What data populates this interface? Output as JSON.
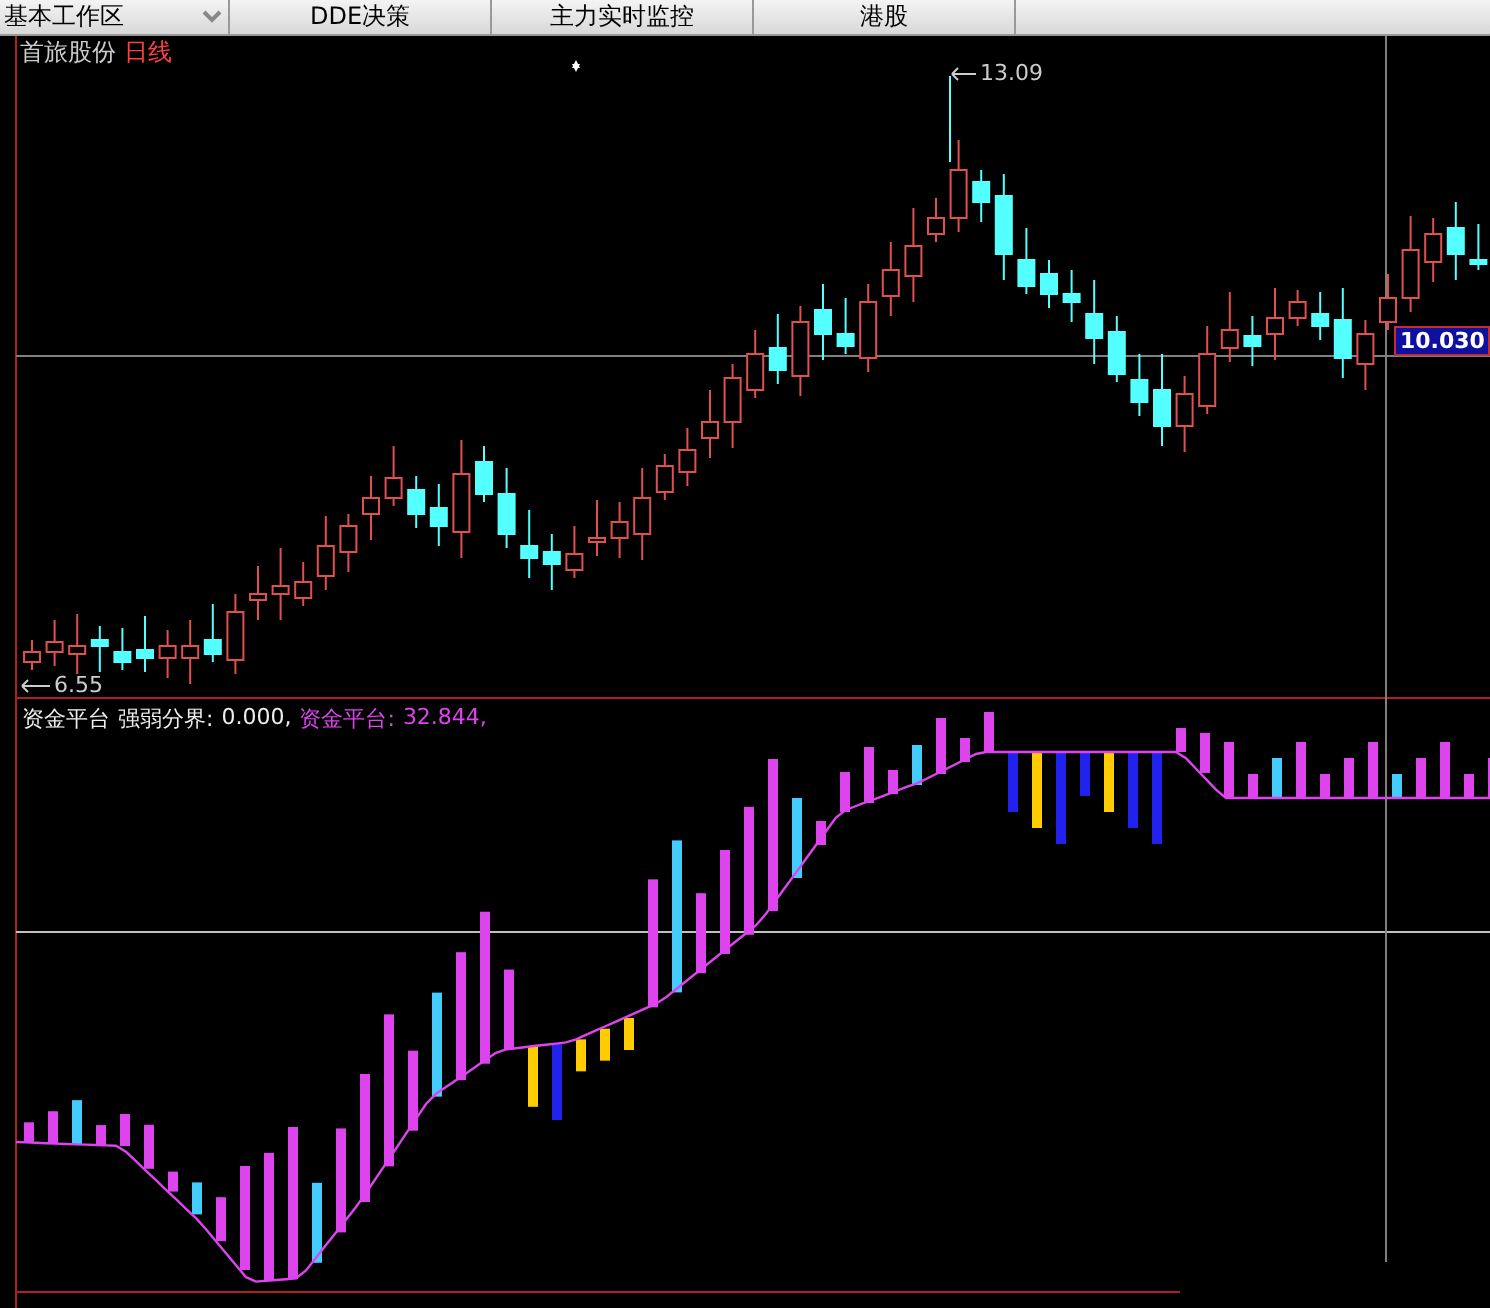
{
  "tabs": [
    {
      "label": "基本工作区",
      "kind": "dropdown"
    },
    {
      "label": "DDE决策",
      "kind": "tab"
    },
    {
      "label": "主力实时监控",
      "kind": "tab"
    },
    {
      "label": "港股",
      "kind": "tab"
    }
  ],
  "price_chart": {
    "stock_name": "首旅股份",
    "period": "日线",
    "high_label": "13.09",
    "low_label": "6.55",
    "cursor_price": "10.030"
  },
  "indicator": {
    "name": "资金平台",
    "boundary_label": "强弱分界:",
    "boundary_value": "0.000,",
    "platform_label": "资金平台:",
    "platform_value": "32.844,"
  }
}
